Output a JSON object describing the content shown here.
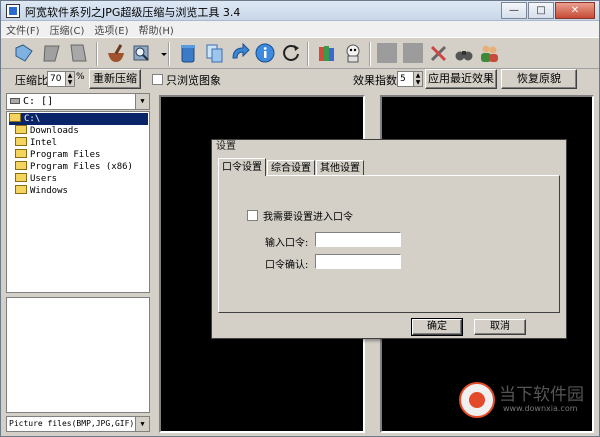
{
  "window": {
    "title": "阿宽软件系列之JPG超级压缩与浏览工具 3.4",
    "min_glyph": "—",
    "max_glyph": "□",
    "close_glyph": "✕"
  },
  "menu": [
    "文件(F)",
    "压缩(C)",
    "选项(E)",
    "帮助(H)"
  ],
  "optbar": {
    "ratio_label": "压缩比",
    "ratio_value": "70",
    "ratio_unit": "%",
    "recompress_button": "重新压缩",
    "browse_only_label": "只浏览图象",
    "effect_label": "效果指数",
    "effect_value": "5",
    "apply_button": "应用最近效果",
    "restore_button": "恢复原貌"
  },
  "left_panel": {
    "drive": "C: []",
    "tree": [
      {
        "label": "C:\\",
        "selected": true
      },
      {
        "label": "Downloads",
        "selected": false
      },
      {
        "label": "Intel",
        "selected": false
      },
      {
        "label": "Program Files",
        "selected": false
      },
      {
        "label": "Program Files (x86)",
        "selected": false
      },
      {
        "label": "Users",
        "selected": false
      },
      {
        "label": "Windows",
        "selected": false
      }
    ],
    "filter": "Picture files(BMP,JPG,GIF)"
  },
  "dialog": {
    "title": "设置",
    "tabs": [
      "口令设置",
      "综合设置",
      "其他设置"
    ],
    "checkbox_label": "我需要设置进入口令",
    "password_label": "输入口令:",
    "password_value": "",
    "confirm_label": "口令确认:",
    "confirm_value": "",
    "ok_button": "确定",
    "cancel_button": "取消"
  },
  "watermark": {
    "brand": "当下软件园",
    "url": "www.downxia.com"
  },
  "colors": {
    "selection": "#0a246a",
    "viewer_bg": "#000000",
    "chrome": "#d4d0c8"
  }
}
